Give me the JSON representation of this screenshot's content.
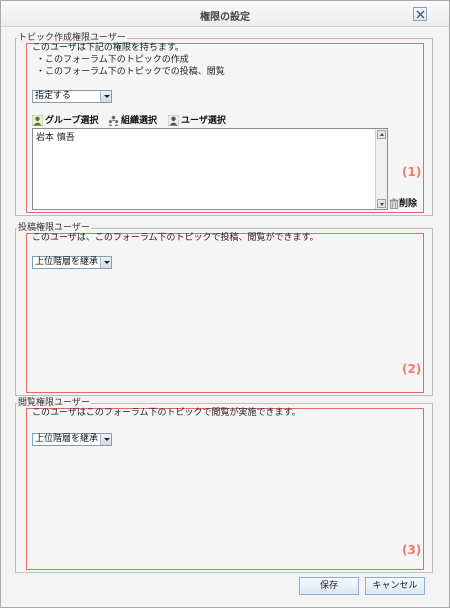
{
  "dialog": {
    "title": "権限の設定"
  },
  "sections": {
    "topic_create": {
      "legend": "トピック作成権限ユーザー",
      "desc_line1": "このユーザは下記の権限を持ちます。",
      "desc_line2": "・このフォーラム下のトピックの作成",
      "desc_line3": "・このフォーラム下のトピックでの投稿、閲覧",
      "select_value": "指定する",
      "group_select": "グループ選択",
      "org_select": "組織選択",
      "user_select": "ユーザ選択",
      "users": [
        "岩本 慎吾"
      ],
      "delete_label": "削除",
      "marker": "(1)"
    },
    "post": {
      "legend": "投稿権限ユーザー",
      "desc_line1": "このユーザは、このフォーラム下のトピックで投稿、閲覧ができます。",
      "select_value": "上位階層を継承",
      "marker": "(2)"
    },
    "view": {
      "legend": "閲覧権限ユーザー",
      "desc_line1": "このユーザはこのフォーラム下のトピックで閲覧が実施できます。",
      "select_value": "上位階層を継承",
      "marker": "(3)"
    }
  },
  "footer": {
    "save_label": "保存",
    "cancel_label": "キャンセル"
  }
}
